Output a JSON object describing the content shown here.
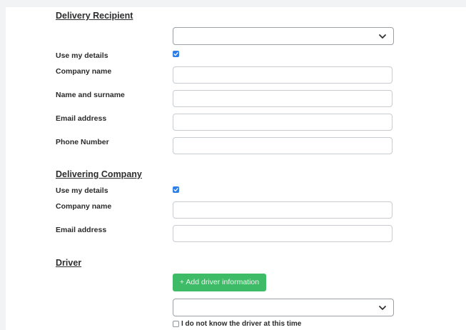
{
  "recipient": {
    "title": "Delivery Recipient",
    "select_value": "",
    "use_details_label": "Use my details",
    "use_details_checked": true,
    "company_label": "Company name",
    "company_value": "",
    "name_label": "Name and surname",
    "name_value": "",
    "email_label": "Email address",
    "email_value": "",
    "phone_label": "Phone Number",
    "phone_value": ""
  },
  "delivering": {
    "title": "Delivering Company",
    "use_details_label": "Use my details",
    "use_details_checked": true,
    "company_label": "Company name",
    "company_value": "",
    "email_label": "Email address",
    "email_value": ""
  },
  "driver": {
    "title": "Driver",
    "add_button_label": "+ Add driver information",
    "select_value": "",
    "unknown_label": "I do not know the driver at this time",
    "unknown_checked": false
  },
  "colors": {
    "accent_blue": "#2f7fe8",
    "button_green": "#3dbb67"
  },
  "icons": {
    "select_arrow": "chevron-down-icon",
    "checkmark": "check-icon"
  }
}
